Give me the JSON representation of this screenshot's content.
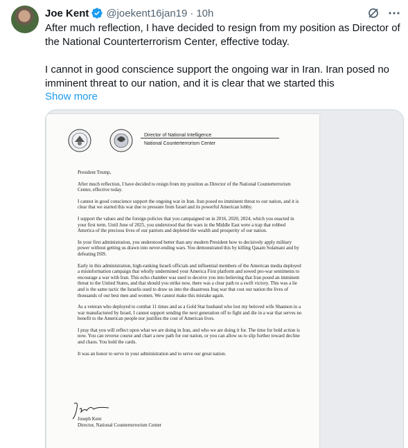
{
  "tweet": {
    "author_name": "Joe Kent",
    "handle": "@joekent16jan19",
    "separator": "·",
    "time": "10h",
    "text_p1": "After much reflection, I have decided to resign from my position as Director of the National Counterterrorism Center, effective today.",
    "text_p2": "I cannot in good conscience support the ongoing war in Iran. Iran posed no imminent threat to our nation, and it is clear that we started this",
    "show_more": "Show more",
    "icons": {
      "verified": "verified-badge-icon",
      "grok": "grok-icon",
      "more": "more-dots-icon"
    },
    "colors": {
      "link": "#1d9bf0",
      "verified": "#1d9bf0",
      "muted": "#536471"
    }
  },
  "letter": {
    "letterhead_line1": "Director of National Intelligence",
    "letterhead_line2": "National Counterterrorism Center",
    "salutation": "President Trump,",
    "paragraphs": [
      "After much reflection, I have decided to resign from my position as Director of the National Counterterrorism Center, effective today.",
      "I cannot in good conscience support the ongoing war in Iran. Iran posed no imminent threat to our nation, and it is clear that we started this war due to pressure from Israel and its powerful American lobby.",
      "I support the values and the foreign policies that you campaigned on in 2016, 2020, 2024, which you enacted in your first term. Until June of 2025, you understood that the wars in the Middle East were a trap that robbed America of the precious lives of our patriots and depleted the wealth and prosperity of our nation.",
      "In your first administration, you understood better than any modern President how to decisively apply military power without getting us drawn into never-ending wars. You demonstrated this by killing Qasam Solamani and by defeating ISIS.",
      "Early in this administration, high-ranking Israeli officials and influential members of the American media deployed a misinformation campaign that wholly undermined your America First platform and sowed pro-war sentiments to encourage a war with Iran. This echo chamber was used to deceive you into believing that Iran posed an imminent threat to the United States, and that should you strike now, there was a clear path to a swift victory. This was a lie and is the same tactic the Israelis used to draw us into the disastrous Iraq war that cost our nation the lives of thousands of our best men and women. We cannot make this mistake again.",
      "As a veteran who deployed to combat 11 times and as a Gold Star husband who lost my beloved wife Shannon in a war manufactured by Israel, I cannot support sending the next generation off to fight and die in a war that serves no benefit to the American people nor justifies the cost of American lives.",
      "I pray that you will reflect upon what we are doing in Iran, and who we are doing it for. The time for bold action is now. You can reverse course and chart a new path for our nation, or you can allow us to slip further toward decline and chaos. You hold the cards.",
      "It was an honor to serve in your administration and to serve our great nation."
    ],
    "signer_name": "Joseph Kent",
    "signer_title": "Director, National Counterterrorism Center"
  }
}
